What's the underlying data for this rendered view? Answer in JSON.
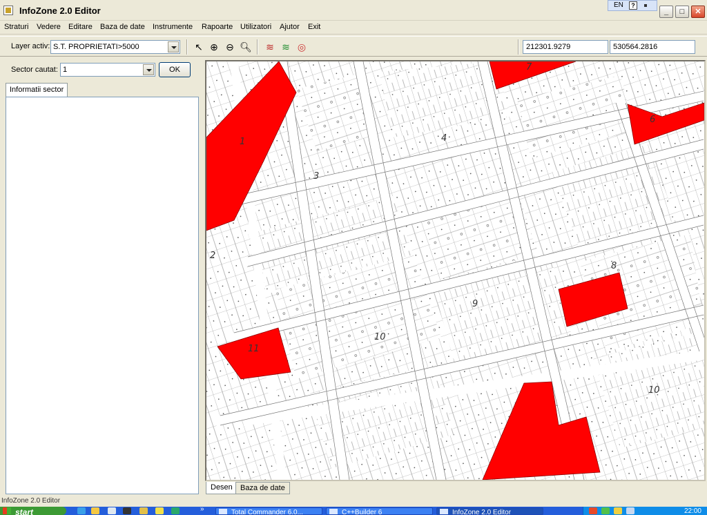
{
  "window": {
    "title": "InfoZone 2.0 Editor",
    "lang": "EN",
    "controls": {
      "minimize": "_",
      "maximize": "□",
      "close": "✕"
    }
  },
  "menu": [
    "Straturi",
    "Vedere",
    "Editare",
    "Baza de date",
    "Instrumente",
    "Rapoarte",
    "Utilizatori",
    "Ajutor",
    "Exit"
  ],
  "toolbar": {
    "layer_label": "Layer activ:",
    "layer_value": "S.T. PROPRIETATI>5000",
    "tools": [
      "pointer-icon",
      "zoom-in-icon",
      "zoom-out-icon",
      "zoom-fit-icon",
      "layers-icon",
      "layers-color-icon",
      "target-icon"
    ],
    "coord_x": "212301.9279",
    "coord_y": "530564.2816"
  },
  "left_panel": {
    "sector_label": "Sector cautat:",
    "sector_value": "1",
    "ok_label": "OK",
    "tab_label": "Informatii sector"
  },
  "map": {
    "highlight_color": "#ff0000",
    "sector_labels": [
      "1",
      "2",
      "3",
      "4",
      "7",
      "6",
      "8",
      "9",
      "10",
      "11",
      "10"
    ]
  },
  "bottom_tabs": [
    "Desen",
    "Baza de date"
  ],
  "status": {
    "text": "InfoZone 2.0 Editor"
  },
  "taskbar": {
    "start_label": "start",
    "tasks": [
      "Total Commander 6.0...",
      "C++Builder 6",
      "InfoZone 2.0 Editor"
    ],
    "clock": "22:00"
  }
}
